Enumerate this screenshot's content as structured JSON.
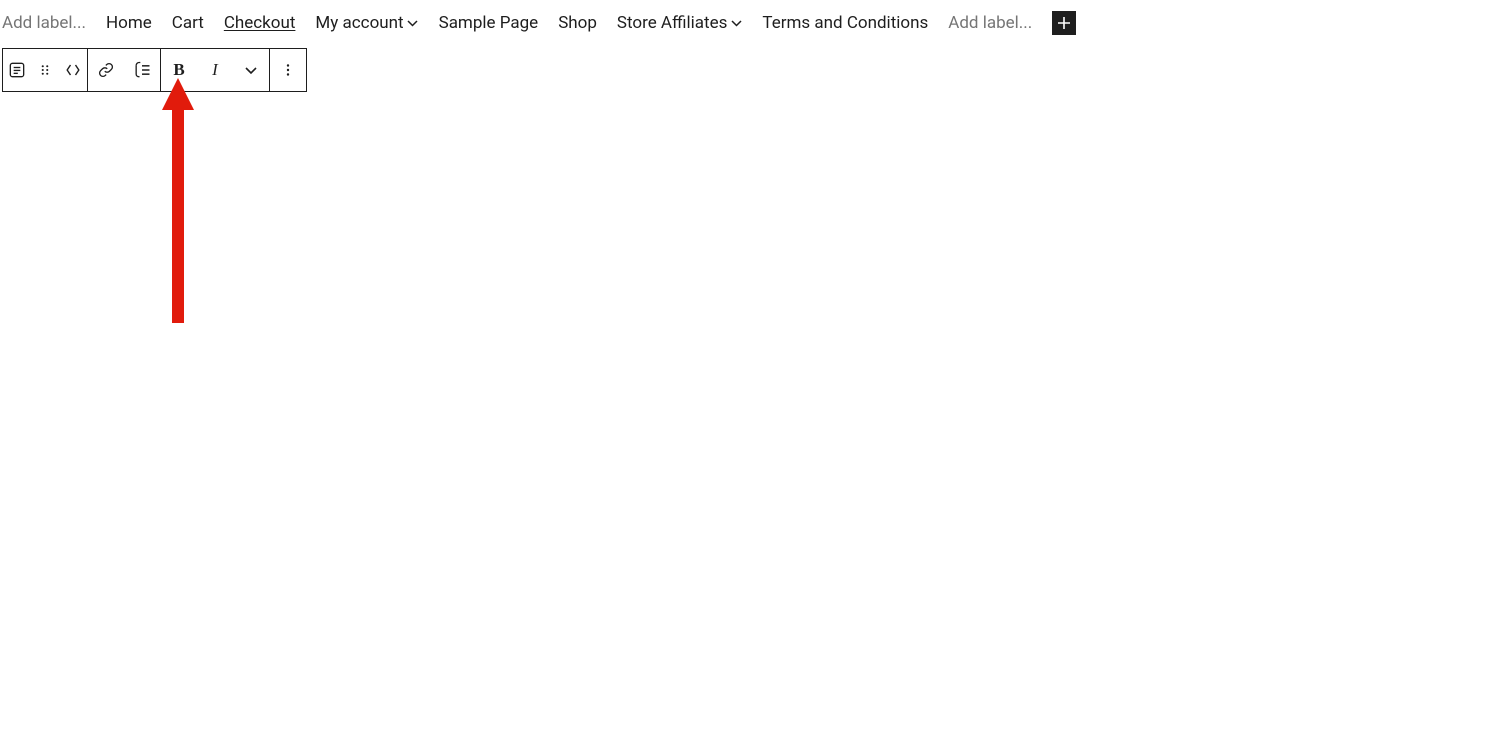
{
  "nav": {
    "add_label_left": "Add label...",
    "items": [
      {
        "label": "Home",
        "has_submenu": false,
        "selected": false
      },
      {
        "label": "Cart",
        "has_submenu": false,
        "selected": false
      },
      {
        "label": "Checkout",
        "has_submenu": false,
        "selected": true
      },
      {
        "label": "My account",
        "has_submenu": true,
        "selected": false
      },
      {
        "label": "Sample Page",
        "has_submenu": false,
        "selected": false
      },
      {
        "label": "Shop",
        "has_submenu": false,
        "selected": false
      },
      {
        "label": "Store Affiliates",
        "has_submenu": true,
        "selected": false
      },
      {
        "label": "Terms and Conditions",
        "has_submenu": false,
        "selected": false
      }
    ],
    "add_label_right": "Add label..."
  },
  "toolbar": {
    "block_type": "navigation-link",
    "drag": "drag-handle",
    "move": "move-arrows",
    "link": "link",
    "submenu": "add-submenu",
    "bold_label": "B",
    "italic_label": "I",
    "more_formatting": "more-formatting",
    "more_options": "options"
  },
  "annotation": {
    "type": "arrow",
    "color": "#E11B0C",
    "points_to": "add-submenu-button"
  }
}
